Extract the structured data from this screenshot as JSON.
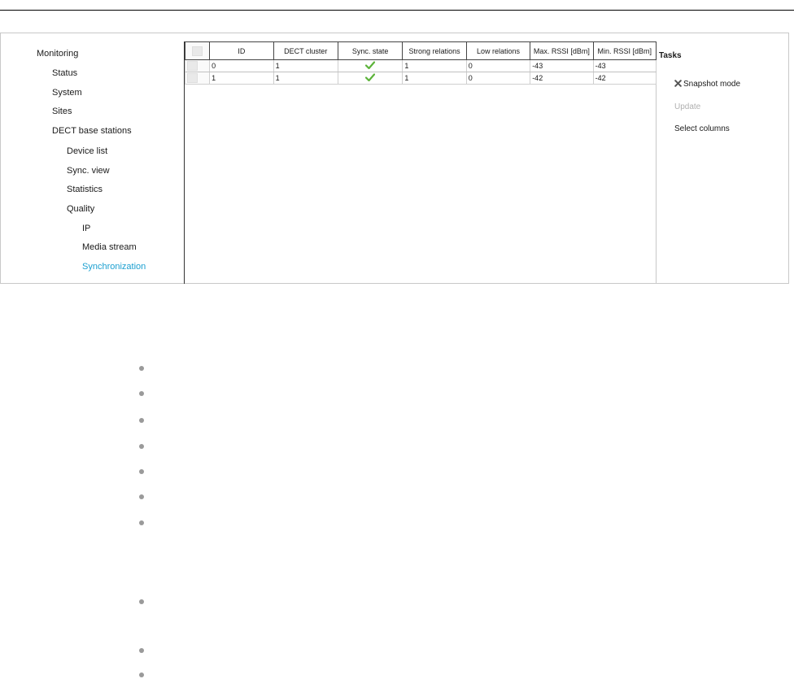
{
  "nav": {
    "items": [
      {
        "label": "Monitoring"
      },
      {
        "label": "Status"
      },
      {
        "label": "System"
      },
      {
        "label": "Sites"
      },
      {
        "label": "DECT base stations"
      },
      {
        "label": "Device list"
      },
      {
        "label": "Sync. view"
      },
      {
        "label": "Statistics"
      },
      {
        "label": "Quality"
      },
      {
        "label": "IP"
      },
      {
        "label": "Media stream"
      },
      {
        "label": "Synchronization"
      }
    ],
    "active_color": "#1a9fd0"
  },
  "table": {
    "headers": [
      "ID",
      "DECT cluster",
      "Sync. state",
      "Strong relations",
      "Low relations",
      "Max. RSSI [dBm]",
      "Min. RSSI [dBm]"
    ],
    "rows": [
      {
        "id": "0",
        "cluster": "1",
        "sync_icon": "check-icon",
        "strong": "1",
        "low": "0",
        "max_rssi": "-43",
        "min_rssi": "-43"
      },
      {
        "id": "1",
        "cluster": "1",
        "sync_icon": "check-icon",
        "strong": "1",
        "low": "0",
        "max_rssi": "-42",
        "min_rssi": "-42"
      }
    ],
    "check_color": "#5cb33a"
  },
  "tasks": {
    "title": "Tasks",
    "snapshot": "Snapshot mode",
    "snapshot_icon": "close-icon",
    "update": "Update",
    "select_columns": "Select columns"
  },
  "bullets": {
    "count": 9,
    "icon": "bullet-dot",
    "color": "#9a9a9a"
  }
}
